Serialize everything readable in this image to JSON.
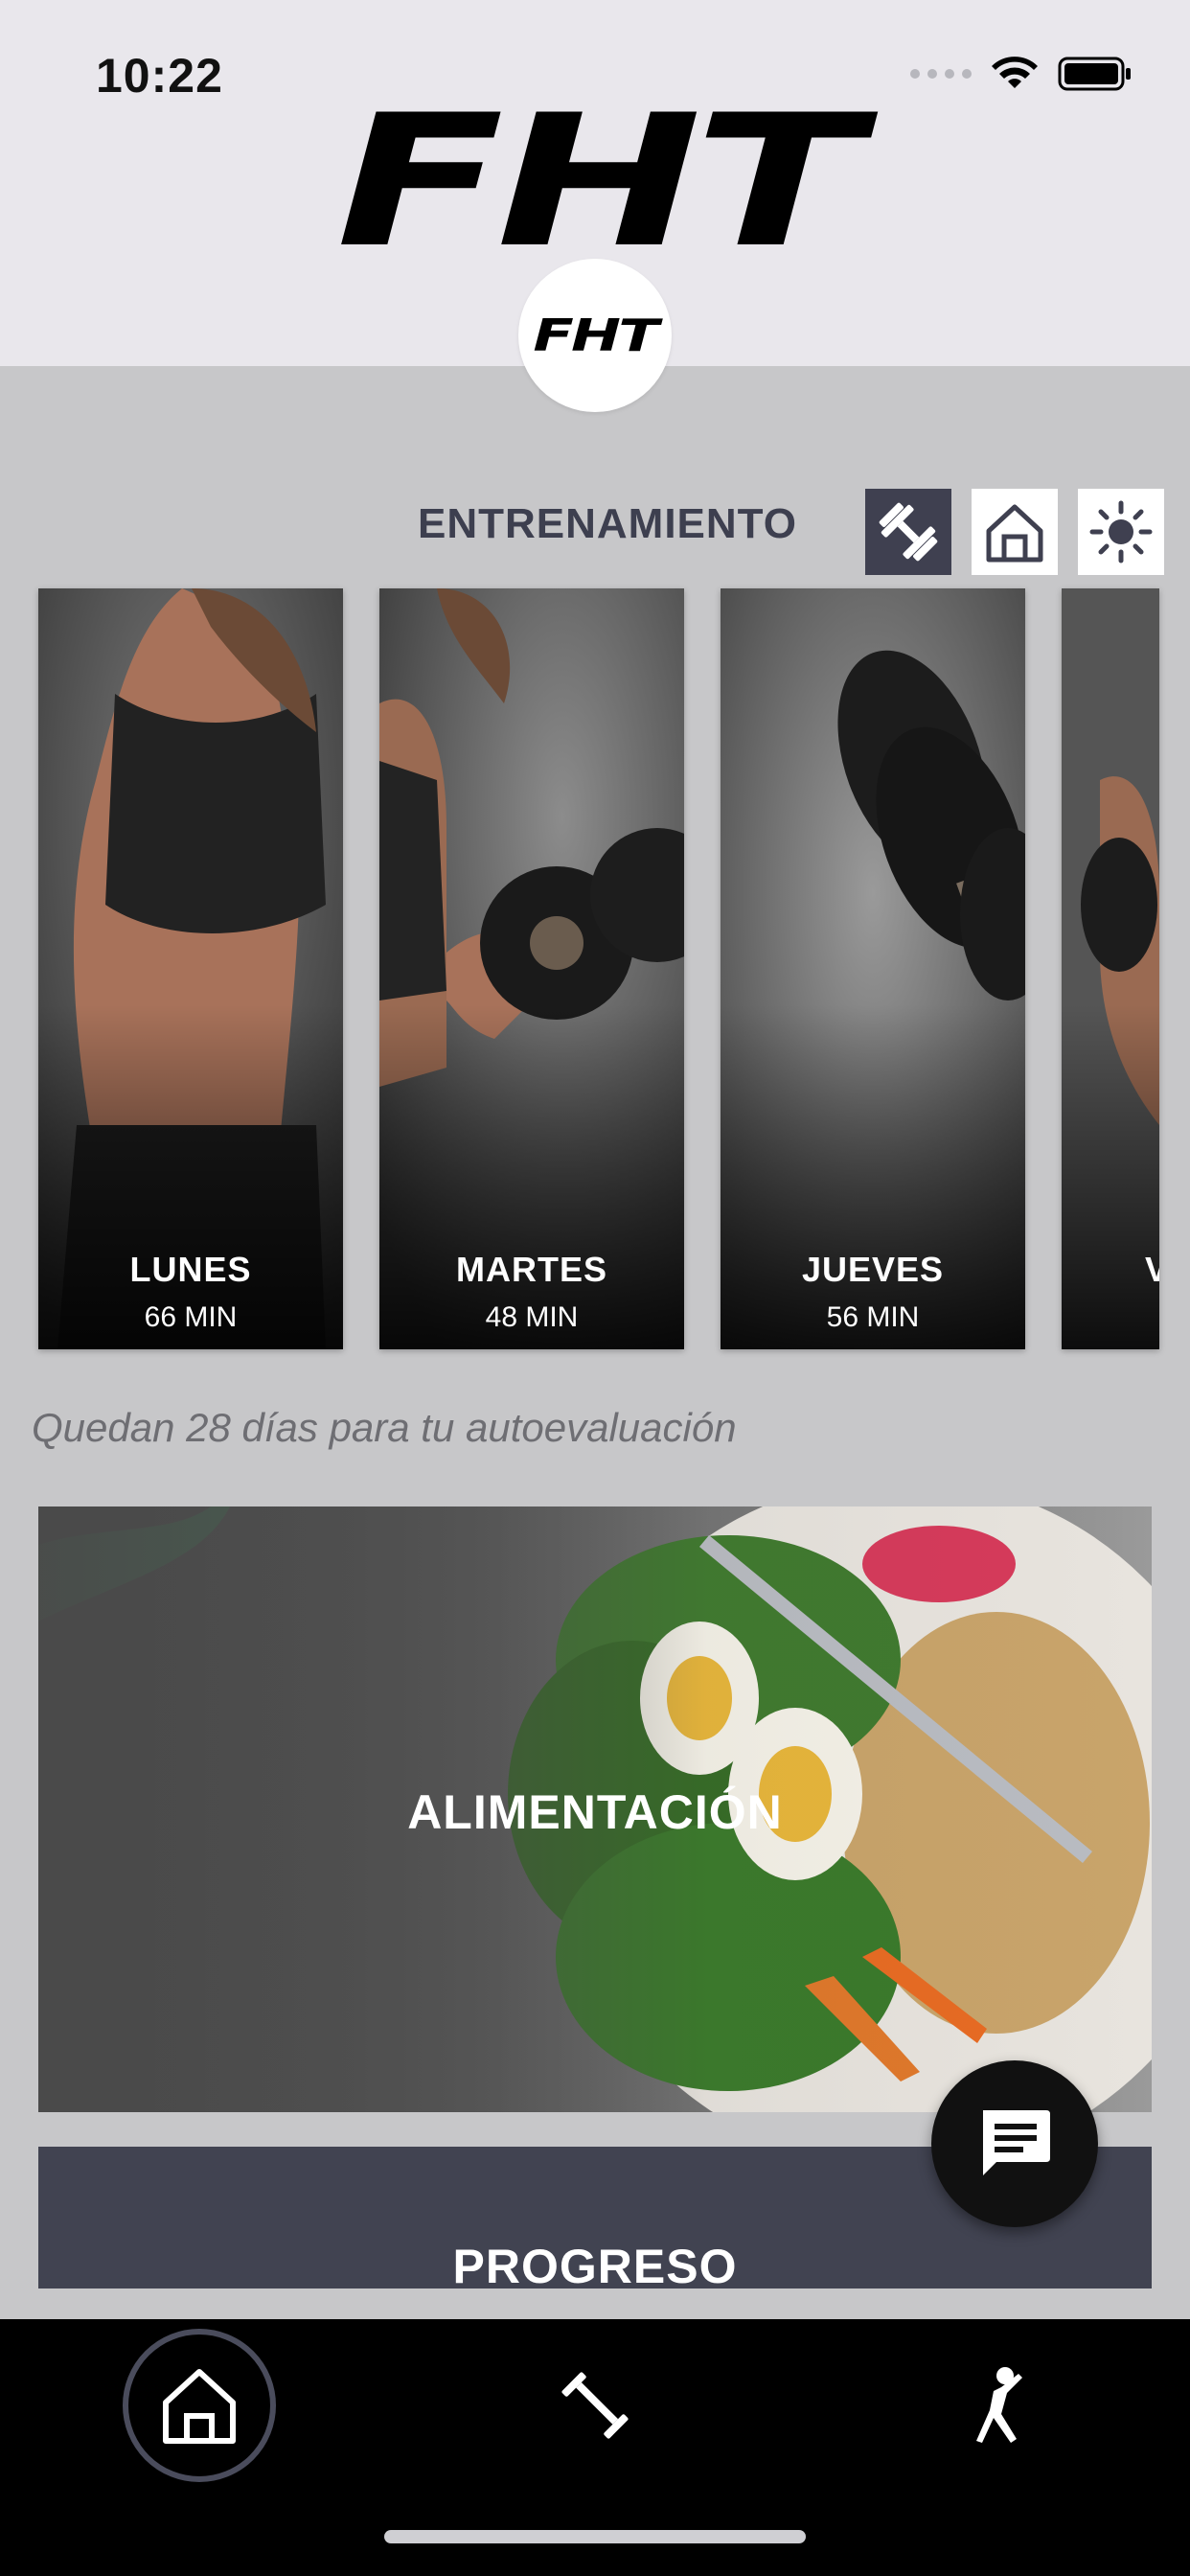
{
  "status_bar": {
    "time": "10:22"
  },
  "brand": {
    "logo_text": "FHT",
    "badge_text": "FHT"
  },
  "training": {
    "section_title": "ENTRENAMIENTO",
    "modes": [
      {
        "icon": "dumbbell-icon",
        "active": true
      },
      {
        "icon": "home-icon",
        "active": false
      },
      {
        "icon": "sun-icon",
        "active": false
      }
    ],
    "days": [
      {
        "name": "LUNES",
        "duration": "66 MIN"
      },
      {
        "name": "MARTES",
        "duration": "48 MIN"
      },
      {
        "name": "JUEVES",
        "duration": "56 MIN"
      },
      {
        "name": "V",
        "duration": ""
      }
    ]
  },
  "evaluation_note": "Quedan 28 días para tu autoevaluación",
  "nutrition": {
    "title": "ALIMENTACIÓN"
  },
  "progress": {
    "title": "PROGRESO"
  },
  "bottom_nav": {
    "items": [
      {
        "icon": "home-icon",
        "active": true
      },
      {
        "icon": "dumbbell-icon",
        "active": false
      },
      {
        "icon": "stretching-person-icon",
        "active": false
      }
    ]
  },
  "colors": {
    "background": "#c7c7c9",
    "header": "#e9e7ec",
    "accent_dark": "#3f4050",
    "nav": "#000000"
  }
}
